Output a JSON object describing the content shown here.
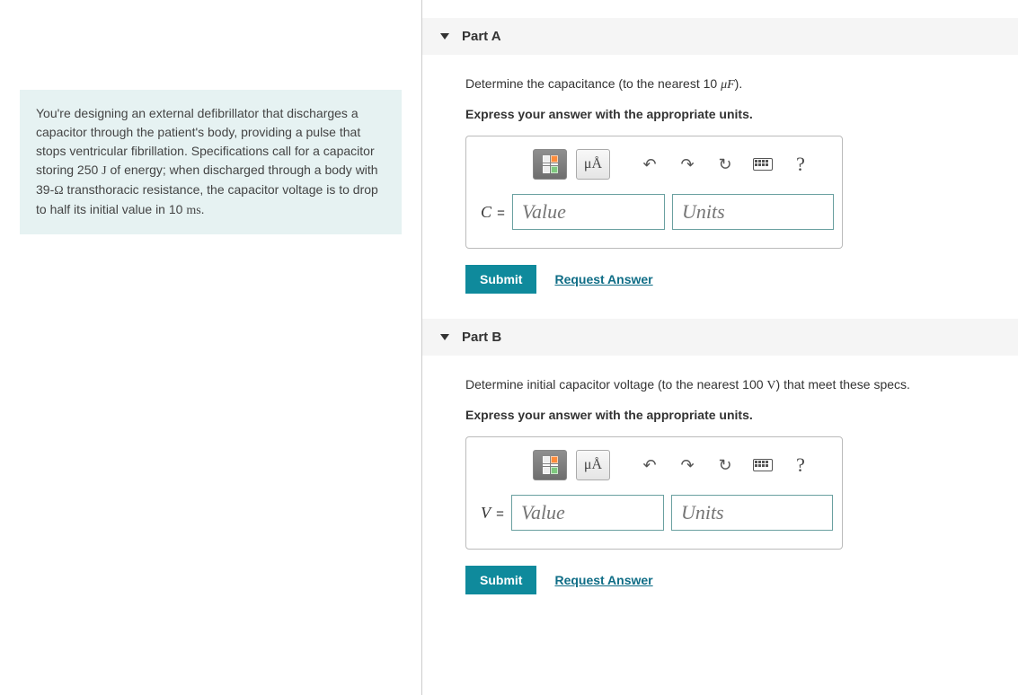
{
  "intro": {
    "text_before_J": "You're designing an external defibrillator that discharges a capacitor through the patient's body, providing a pulse that stops ventricular fibrillation. Specifications call for a capacitor storing 250 ",
    "unit_J": "J",
    "text_mid1": " of energy; when discharged through a body with 39-",
    "unit_ohm": "Ω",
    "text_mid2": " transthoracic resistance, the capacitor voltage is to drop to half its initial value in 10 ",
    "unit_ms": "ms",
    "text_end": "."
  },
  "parts": {
    "a": {
      "title": "Part A",
      "prompt_before": "Determine the capacitance (to the nearest 10 ",
      "prompt_unit": "μF",
      "prompt_after": ").",
      "instruct": "Express your answer with the appropriate units.",
      "var": "C",
      "eq": " =",
      "value_ph": "Value",
      "units_ph": "Units",
      "submit": "Submit",
      "request": "Request Answer"
    },
    "b": {
      "title": "Part B",
      "prompt_before": "Determine initial capacitor voltage (to the nearest 100 ",
      "prompt_unit": "V",
      "prompt_after": ") that meet these specs.",
      "instruct": "Express your answer with the appropriate units.",
      "var": "V",
      "eq": " =",
      "value_ph": "Value",
      "units_ph": "Units",
      "submit": "Submit",
      "request": "Request Answer"
    }
  },
  "toolbar": {
    "fraction": "fraction",
    "units_btn": "μÅ",
    "undo": "↶",
    "redo": "↷",
    "reset": "↻",
    "keyboard": "⌨",
    "help": "?"
  }
}
